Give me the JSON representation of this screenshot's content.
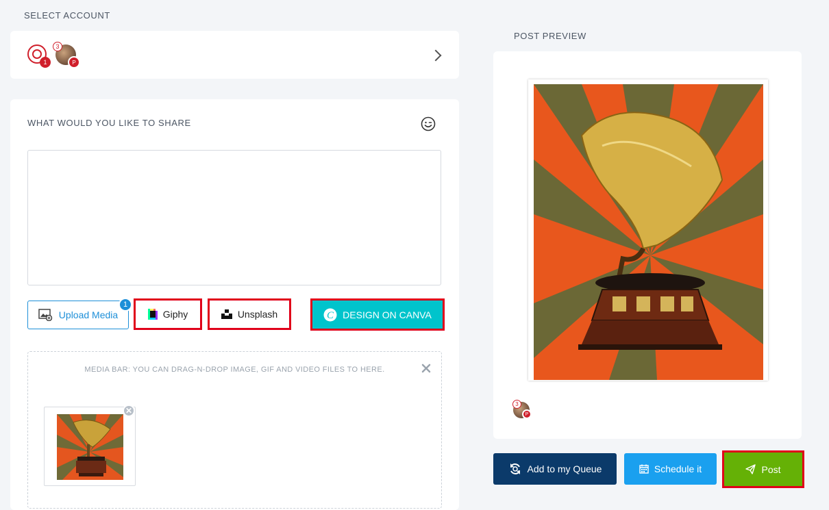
{
  "select_account": {
    "label": "SELECT ACCOUNT",
    "pinterest_count": "1",
    "profile_count": "3"
  },
  "share": {
    "label": "WHAT WOULD YOU LIKE TO SHARE",
    "text_value": "",
    "upload_label": "Upload Media",
    "upload_count": "1",
    "giphy_label": "Giphy",
    "unsplash_label": "Unsplash",
    "canva_label": "DESIGN ON CANVA",
    "media_bar_text": "MEDIA BAR: YOU CAN DRAG-N-DROP IMAGE, GIF AND VIDEO FILES TO HERE.",
    "thumb_remove": "✕"
  },
  "preview": {
    "label": "POST PREVIEW",
    "profile_count": "3"
  },
  "actions": {
    "queue_label": "Add to my Queue",
    "schedule_label": "Schedule it",
    "post_label": "Post"
  },
  "colors": {
    "canva": "#00c4cc",
    "post": "#65b106",
    "queue": "#0b3a6a",
    "schedule": "#1aa0ef",
    "pinterest": "#d01f2b",
    "highlight": "#e0001a"
  }
}
